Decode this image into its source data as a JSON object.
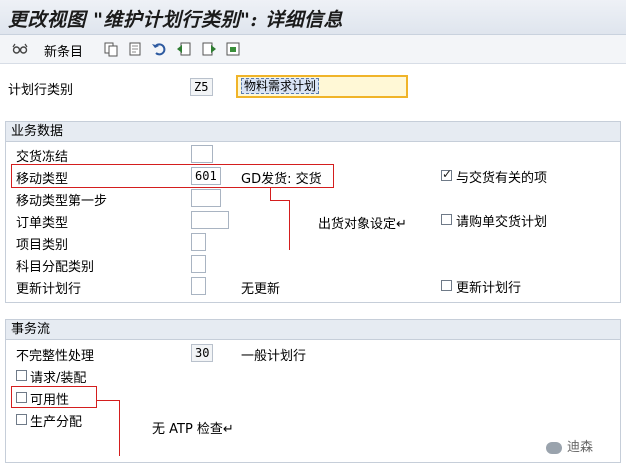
{
  "title": "更改视图 \"维护计划行类别\": 详细信息",
  "toolbar": {
    "new_entries_label": "新条目",
    "icons": [
      "glasses-icon",
      "copy-icon",
      "delete-icon",
      "undo-icon",
      "prev-icon",
      "next-icon",
      "select-icon"
    ]
  },
  "header_field": {
    "label": "计划行类别",
    "code": "Z5",
    "description": "物料需求计划"
  },
  "business_data": {
    "title": "业务数据",
    "delivery_block": {
      "label": "交货冻结",
      "value": ""
    },
    "movement_type": {
      "label": "移动类型",
      "value": "601",
      "text": "GD发货: 交货"
    },
    "movement_type_step1": {
      "label": "移动类型第一步",
      "value": ""
    },
    "order_type": {
      "label": "订单类型",
      "value": ""
    },
    "item_category": {
      "label": "项目类别",
      "value": ""
    },
    "account_assignment": {
      "label": "科目分配类别",
      "value": ""
    },
    "update_schedule_line": {
      "label": "更新计划行",
      "value": "",
      "text": "无更新"
    },
    "relevant_for_delivery": {
      "label": "与交货有关的项",
      "checked": true
    },
    "purchase_req_delivery_schedule": {
      "label": "请购单交货计划",
      "checked": false
    },
    "update_schedule_line_cb": {
      "label": "更新计划行",
      "checked": false
    }
  },
  "transaction_flow": {
    "title": "事务流",
    "incompletion": {
      "label": "不完整性处理",
      "value": "30",
      "text": "一般计划行"
    },
    "requirements_assembly": {
      "label": "请求/装配",
      "checked": false
    },
    "availability": {
      "label": "可用性",
      "checked": false
    },
    "production_allocation": {
      "label": "生产分配",
      "checked": false
    }
  },
  "annotations": {
    "movement_note": "出货对象设定↵",
    "atp_note": "无 ATP 检查↵"
  },
  "watermark": "迪森"
}
